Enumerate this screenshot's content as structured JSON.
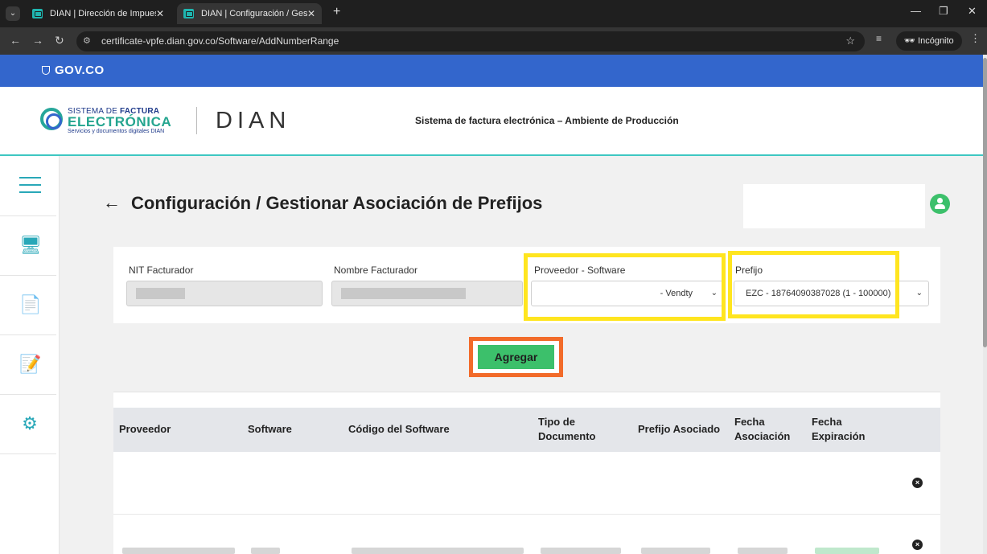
{
  "browser": {
    "tabs": [
      {
        "title": "DIAN | Dirección de Impuestos"
      },
      {
        "title": "DIAN | Configuración / Gestiona"
      }
    ],
    "url": "certificate-vpfe.dian.gov.co/Software/AddNumberRange",
    "incognito_label": "Incógnito"
  },
  "gov_bar": {
    "logo_text": "GOV.CO"
  },
  "header": {
    "brand_line1_prefix": "SISTEMA DE ",
    "brand_line1_bold": "FACTURA",
    "brand_line2": "ELECTRÓNICA",
    "brand_line3": "Servicios y documentos digitales DIAN",
    "dian_logo": "DIAN",
    "system_name": "Sistema de factura electrónica – Ambiente de Producción"
  },
  "page": {
    "title": "Configuración / Gestionar Asociación de Prefijos"
  },
  "form": {
    "nit_label": "NIT Facturador",
    "nombre_label": "Nombre Facturador",
    "proveedor_label": "Proveedor - Software",
    "proveedor_value": "- Vendty",
    "prefijo_label": "Prefijo",
    "prefijo_value": "EZC - 18764090387028 (1 - 100000)",
    "add_button": "Agregar"
  },
  "table": {
    "headers": {
      "proveedor": "Proveedor",
      "software": "Software",
      "codigo": "Código del Software",
      "tipo_l1": "Tipo de",
      "tipo_l2": "Documento",
      "prefijo": "Prefijo Asociado",
      "fecha_asoc_l1": "Fecha",
      "fecha_asoc_l2": "Asociación",
      "fecha_exp_l1": "Fecha",
      "fecha_exp_l2": "Expiración"
    },
    "remove_icon": "×"
  }
}
